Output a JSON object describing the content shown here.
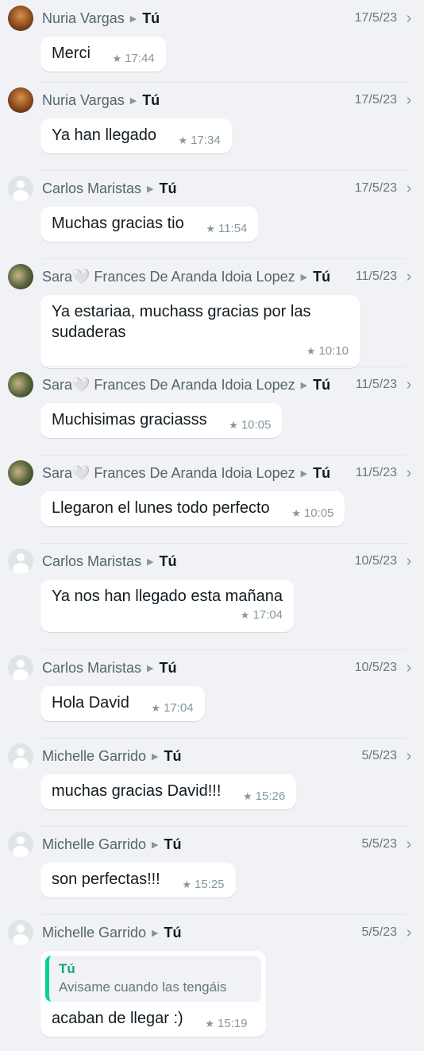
{
  "recipient_label": "Tú",
  "messages": [
    {
      "sender": "Nuria Vargas",
      "avatar": "photo-a",
      "date": "17/5/23",
      "text": "Merci",
      "time": "17:44"
    },
    {
      "sender": "Nuria Vargas",
      "avatar": "photo-a",
      "date": "17/5/23",
      "text": "Ya han llegado",
      "time": "17:34"
    },
    {
      "sender": "Carlos Maristas",
      "avatar": "default",
      "date": "17/5/23",
      "text": "Muchas gracias tio",
      "time": "11:54"
    },
    {
      "sender": "Sara🤍 Frances De Aranda Idoia Lopez",
      "avatar": "photo-b",
      "date": "11/5/23",
      "text": "Ya estariaa, muchass gracias por las sudaderas",
      "time": "10:10",
      "layout": "block"
    },
    {
      "sender": "Sara🤍 Frances De Aranda Idoia Lopez",
      "avatar": "photo-b",
      "date": "11/5/23",
      "text": "Muchisimas graciasss",
      "time": "10:05"
    },
    {
      "sender": "Sara🤍 Frances De Aranda Idoia Lopez",
      "avatar": "photo-b",
      "date": "11/5/23",
      "text": "Llegaron el lunes todo perfecto",
      "time": "10:05"
    },
    {
      "sender": "Carlos Maristas",
      "avatar": "default",
      "date": "10/5/23",
      "text": "Ya nos han llegado esta mañana",
      "time": "17:04",
      "layout": "block"
    },
    {
      "sender": "Carlos Maristas",
      "avatar": "default",
      "date": "10/5/23",
      "text": "Hola David",
      "time": "17:04"
    },
    {
      "sender": "Michelle Garrido",
      "avatar": "default",
      "date": "5/5/23",
      "text": "muchas gracias David!!!",
      "time": "15:26"
    },
    {
      "sender": "Michelle Garrido",
      "avatar": "default",
      "date": "5/5/23",
      "text": "son perfectas!!!",
      "time": "15:25"
    },
    {
      "sender": "Michelle Garrido",
      "avatar": "default",
      "date": "5/5/23",
      "text": "acaban de llegar :)",
      "time": "15:19",
      "quote": {
        "author": "Tú",
        "text": "Avisame cuando las tengáis"
      }
    }
  ],
  "icons": {
    "star": "star-icon",
    "chevron": "chevron-right-icon",
    "avatar": "avatar-icon"
  },
  "colors": {
    "background": "#f0f2f5",
    "bubble": "#ffffff",
    "quote_accent": "#06cf9c",
    "quote_author": "#06a884",
    "meta": "#8696a0"
  }
}
